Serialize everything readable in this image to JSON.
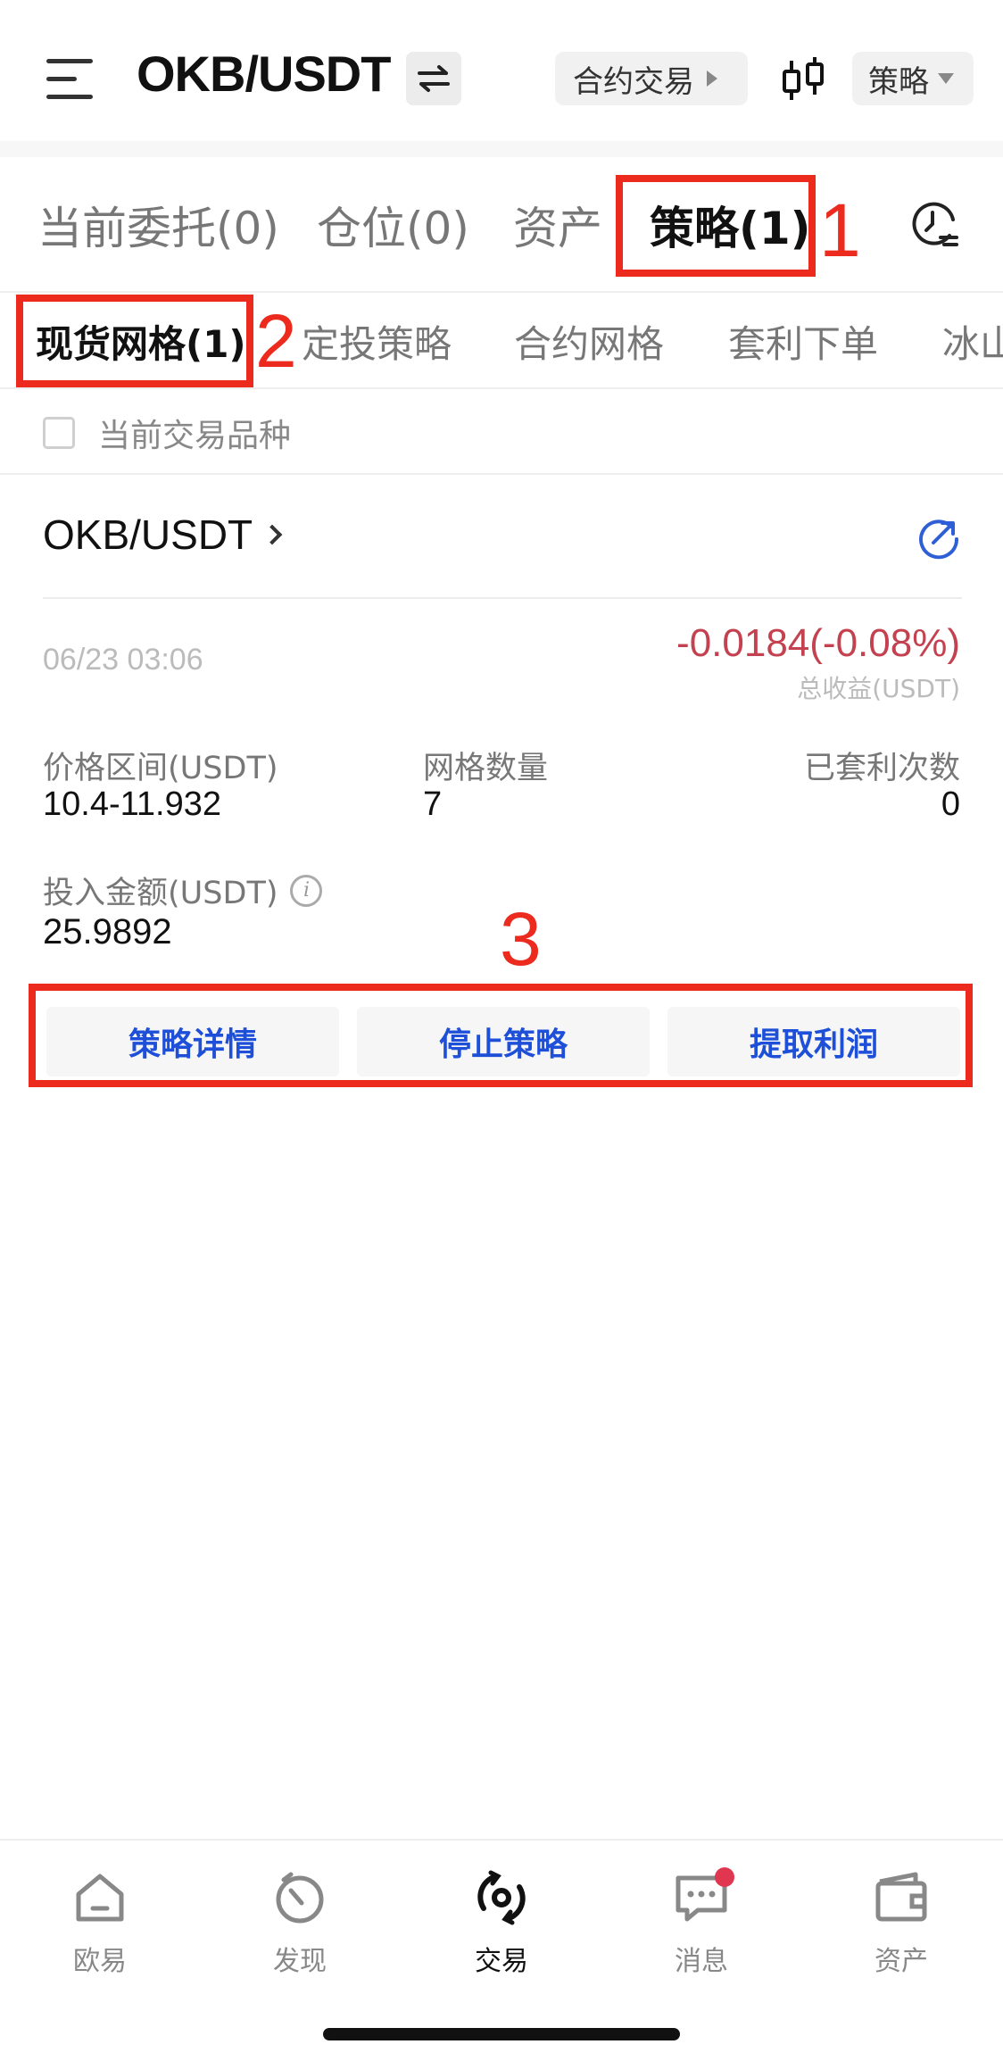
{
  "header": {
    "pair": "OKB/USDT",
    "contract_trade_label": "合约交易",
    "strategy_menu_label": "策略",
    "icons": [
      "menu-icon",
      "swap-icon",
      "candlestick-icon"
    ]
  },
  "tabs": [
    {
      "label": "当前委托(0)",
      "active": false
    },
    {
      "label": "仓位(0)",
      "active": false
    },
    {
      "label": "资产",
      "active": false
    },
    {
      "label": "策略(1)",
      "active": true
    }
  ],
  "subtabs": [
    {
      "label": "现货网格(1)",
      "active": true
    },
    {
      "label": "定投策略",
      "active": false
    },
    {
      "label": "合约网格",
      "active": false
    },
    {
      "label": "套利下单",
      "active": false
    },
    {
      "label": "冰山",
      "active": false
    }
  ],
  "filter": {
    "current_pair_label": "当前交易品种",
    "checked": false
  },
  "strategy_card": {
    "pair": "OKB/USDT",
    "date": "06/23 03:06",
    "total_pnl": "-0.0184(-0.08%)",
    "total_pnl_label": "总收益(USDT)",
    "price_range_label": "价格区间(USDT)",
    "price_range_value": "10.4-11.932",
    "grid_count_label": "网格数量",
    "grid_count_value": "7",
    "arbitrage_count_label": "已套利次数",
    "arbitrage_count_value": "0",
    "investment_label": "投入金额(USDT)",
    "investment_value": "25.9892",
    "actions": {
      "details": "策略详情",
      "stop": "停止策略",
      "withdraw": "提取利润"
    }
  },
  "annotations": {
    "n1": "1",
    "n2": "2",
    "n3": "3"
  },
  "bottom_nav": [
    {
      "label": "欧易",
      "icon": "home-icon",
      "active": false
    },
    {
      "label": "发现",
      "icon": "discover-icon",
      "active": false
    },
    {
      "label": "交易",
      "icon": "trade-icon",
      "active": true
    },
    {
      "label": "消息",
      "icon": "message-icon",
      "active": false
    },
    {
      "label": "资产",
      "icon": "wallet-icon",
      "active": false
    }
  ],
  "colors": {
    "annotation_red": "#ec2a1e",
    "loss_red": "#c4414f",
    "action_blue": "#1e4fd8",
    "badge_red": "#e0364f"
  }
}
